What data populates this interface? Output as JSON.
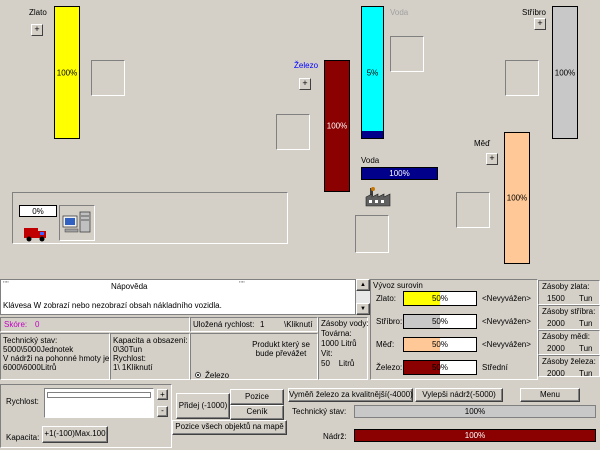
{
  "resources": {
    "gold": {
      "label": "Zlato",
      "level": 1.0,
      "pct": "100%",
      "color": "#ffff00"
    },
    "water": {
      "label": "Voda",
      "level": 0.05,
      "pct": "5%",
      "color": "#00ffff",
      "label_color": "#a0a0a0"
    },
    "silver": {
      "label": "Stříbro",
      "level": 1.0,
      "pct": "100%",
      "color": "#c8c8c8"
    },
    "iron": {
      "label": "Železo",
      "level": 1.0,
      "pct": "100%",
      "color": "#8b0000",
      "label_color": "#0000ff"
    },
    "copper": {
      "label": "Měď",
      "level": 1.0,
      "pct": "100%",
      "color": "#ffc896"
    },
    "water_bar": {
      "label": "Voda",
      "level": 1.0,
      "pct": "100%",
      "color": "#00008b"
    }
  },
  "plus_symbol": "+",
  "minus_symbol": "-",
  "vehicle": {
    "progress": 0.0,
    "pct": "0%"
  },
  "help": {
    "title": "Nápověda",
    "text": "Klávesa W zobrazí nebo nezobrazí obsah nákladního vozidla."
  },
  "stats": {
    "score_label": "Skóre:",
    "score_value": "0",
    "tech_state": "Technický stav:\n5000\\5000Jednotek\nV nádrži na pohonné hmoty je:\n6000\\6000Litrů",
    "capacity": "Kapacita a obsazení:\n0\\30Tun\nRychlost:\n1\\ 1Kliknutí",
    "saved_speed_label": "Uložená rychlost:",
    "saved_speed_value": "1",
    "saved_speed_unit": "\\Kliknutí",
    "product_text": "Produkt který se bude převážet",
    "product_radio": "Železo",
    "water_stock": "Zásoby vody:\nTovárna:\n1000 Litrů\nVit:\n50    Litrů"
  },
  "export": {
    "title": "Vývoz surovin",
    "rows": [
      {
        "label": "Zlato:",
        "pct": "50%",
        "level": 0.5,
        "color": "#ffff00",
        "status": "<Nevyvážen>"
      },
      {
        "label": "Stříbro:",
        "pct": "50%",
        "level": 0.5,
        "color": "#c8c8c8",
        "status": "<Nevyvážen>"
      },
      {
        "label": "Měď:",
        "pct": "50%",
        "level": 0.5,
        "color": "#ffc896",
        "status": "<Nevyvážen>"
      },
      {
        "label": "Železo:",
        "pct": "50%",
        "level": 0.5,
        "color": "#8b0000",
        "status": "Střední"
      }
    ]
  },
  "reserves": [
    {
      "label": "Zásoby zlata:",
      "value": "1500",
      "unit": "Tun"
    },
    {
      "label": "Zásoby stříbra:",
      "value": "2000",
      "unit": "Tun"
    },
    {
      "label": "Zásoby mědi:",
      "value": "2000",
      "unit": "Tun"
    },
    {
      "label": "Zásoby železa:",
      "value": "2000",
      "unit": "Tun"
    }
  ],
  "controls": {
    "speed_label": "Rychlost:",
    "capacity_label": "Kapacita:",
    "capacity_btn": "+1(-100)Max.100",
    "add_btn": "Přidej (-1000)",
    "position_btn": "Pozice",
    "price_btn": "Ceník",
    "all_positions_btn": "Pozice všech objektů na mapě",
    "swap_btn": "Vyměň železo za kvalitnější(-4000)",
    "improve_tank_btn": "Vylepši nádrž(-5000)",
    "menu_btn": "Menu",
    "tech_label": "Technický stav:",
    "tech_pct": "100%",
    "tech_level": 1.0,
    "tank_label": "Nádrž:",
    "tank_pct": "100%",
    "tank_level": 1.0,
    "tank_color": "#8b0000"
  }
}
